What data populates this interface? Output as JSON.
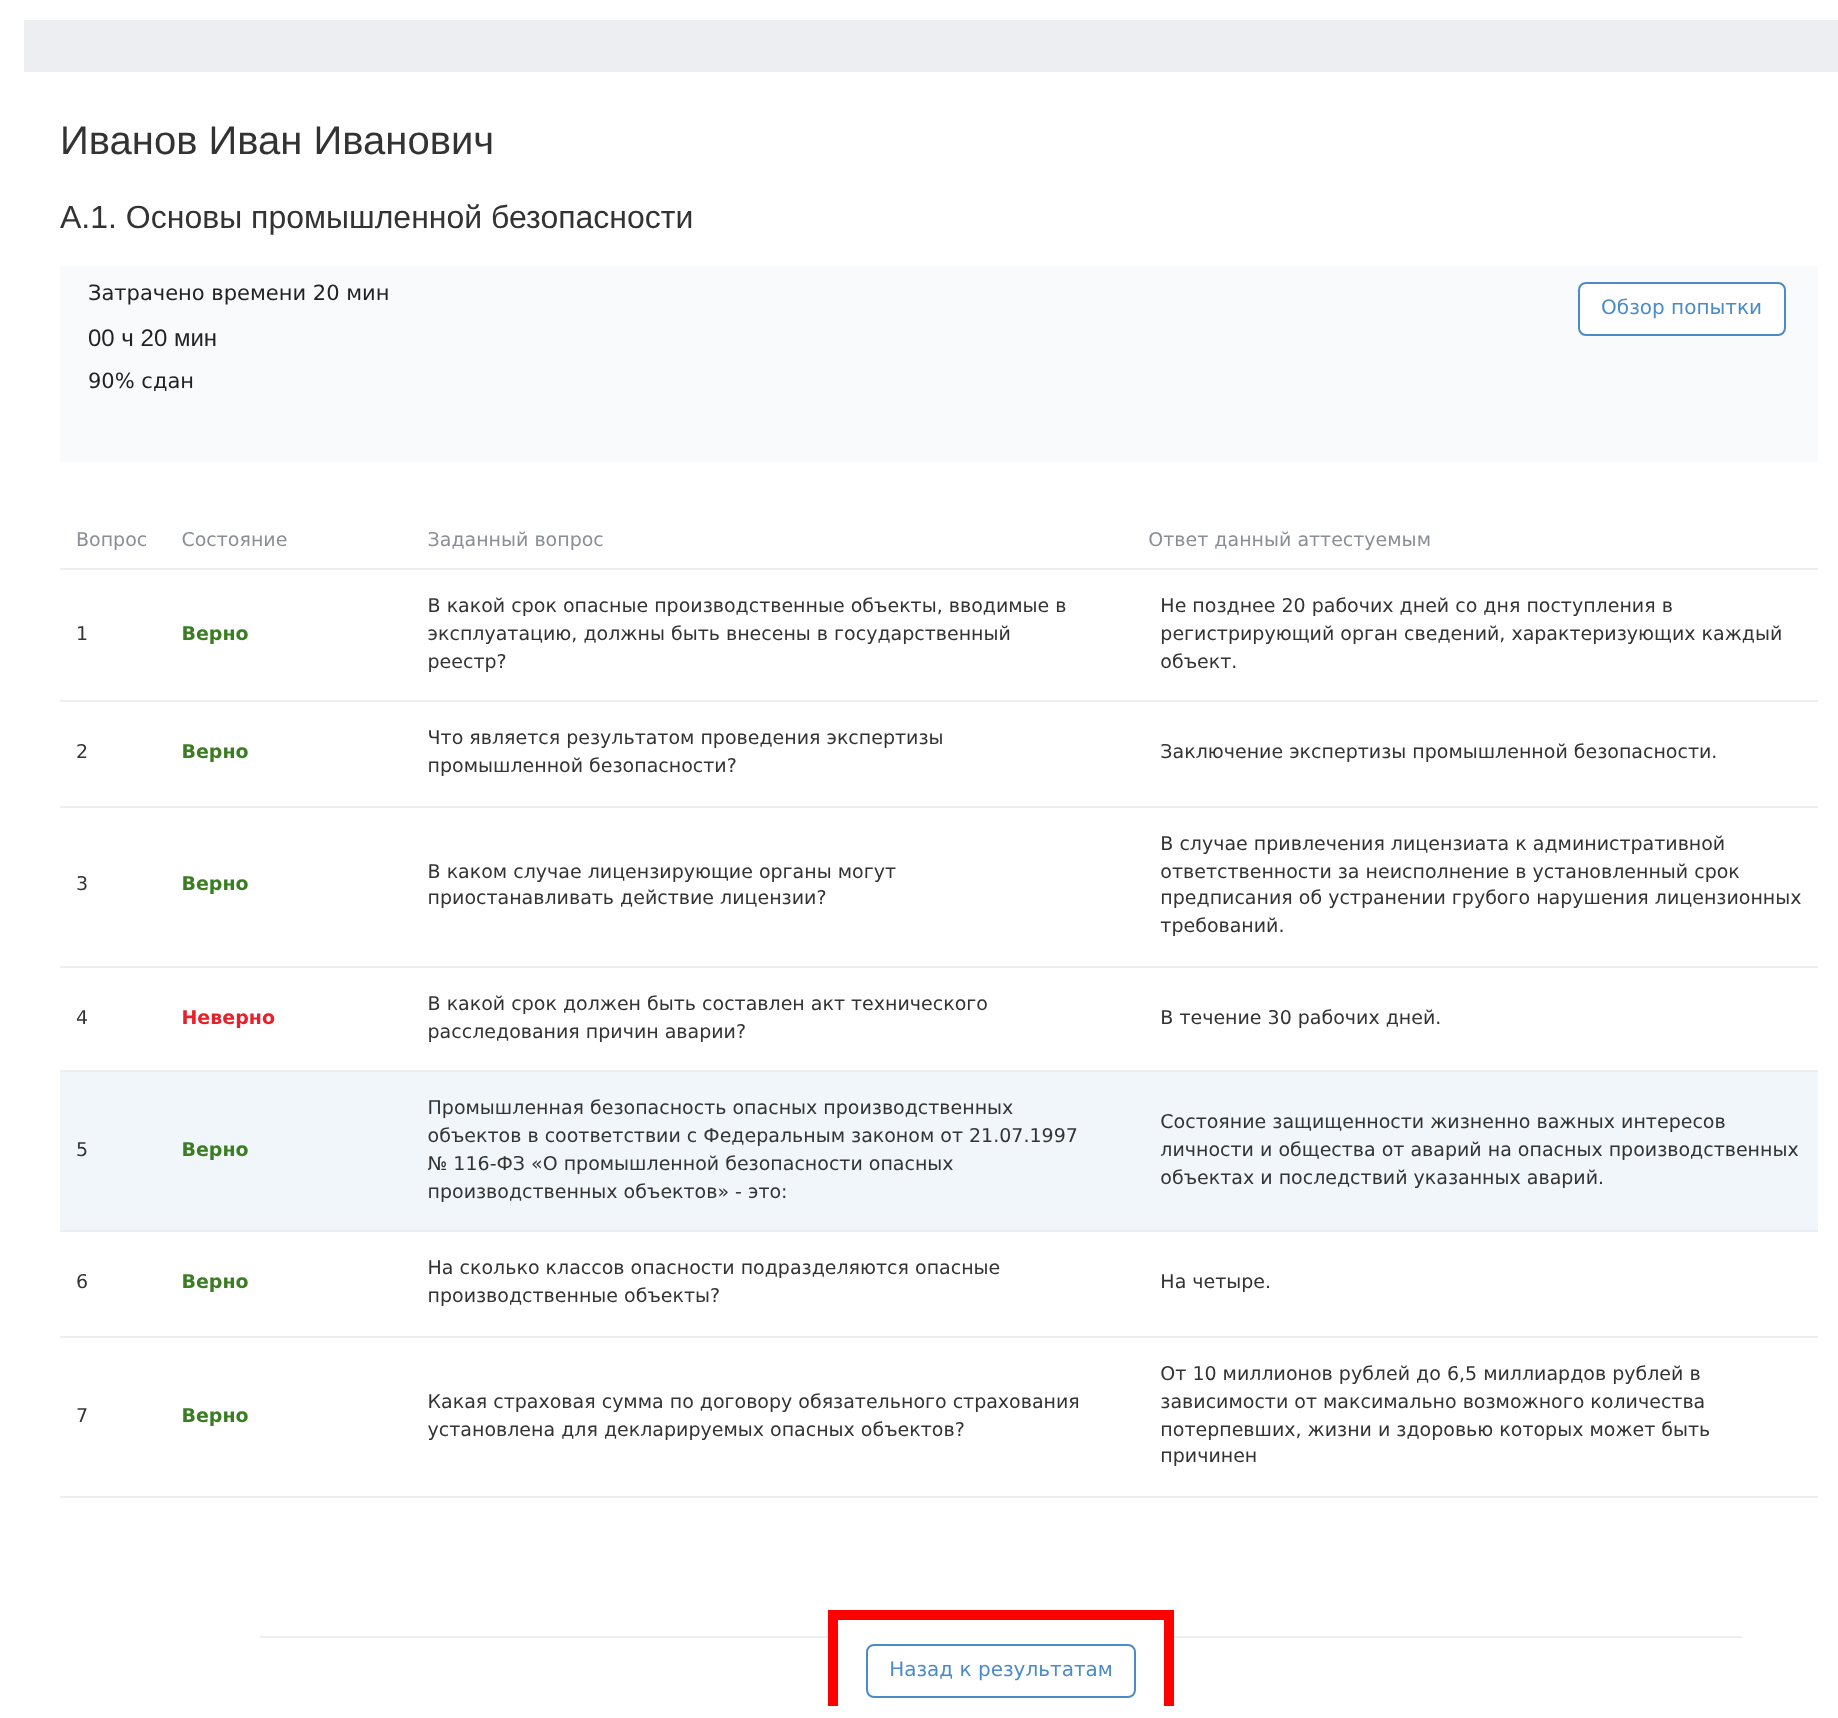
{
  "person": "Иванов Иван Иванович",
  "test_title": "А.1. Основы промышленной безопасности",
  "summary": {
    "time_spent": "Затрачено времени 20 мин",
    "duration": "00 ч 20 мин",
    "result": "90% сдан",
    "review_button": "Обзор попытки"
  },
  "table": {
    "columns": [
      "Вопрос",
      "Состояние",
      "Заданный вопрос",
      "Ответ данный аттестуемым"
    ],
    "rows": [
      {
        "number": "1",
        "status": "Верно",
        "correct": true,
        "selected": false,
        "question": "В какой срок опасные производственные объекты, вводимые в эксплуатацию, должны быть внесены в государственный реестр?",
        "answer": "Не позднее 20 рабочих дней со дня поступления в регистрирующий орган сведений, характеризующих каждый объект."
      },
      {
        "number": "2",
        "status": "Верно",
        "correct": true,
        "selected": false,
        "question": "Что является результатом проведения экспертизы промышленной безопасности?",
        "answer": "Заключение экспертизы промышленной безопасности."
      },
      {
        "number": "3",
        "status": "Верно",
        "correct": true,
        "selected": false,
        "question": "В каком случае лицензирующие органы могут приостанавливать действие лицензии?",
        "answer": "В случае привлечения лицензиата к административной ответственности за неисполнение в установленный срок предписания об устранении грубого нарушения лицензионных требований."
      },
      {
        "number": "4",
        "status": "Неверно",
        "correct": false,
        "selected": false,
        "question": "В какой срок должен быть составлен акт технического расследования причин аварии?",
        "answer": "В течение 30 рабочих дней."
      },
      {
        "number": "5",
        "status": "Верно",
        "correct": true,
        "selected": true,
        "question": "Промышленная безопасность опасных производственных объектов в соответствии с Федеральным законом от 21.07.1997 № 116-ФЗ «О промышленной безопасности опасных производственных объектов» - это:",
        "answer": "Состояние защищенности жизненно важных интересов личности и общества от аварий на опасных производственных объектах и последствий указанных аварий."
      },
      {
        "number": "6",
        "status": "Верно",
        "correct": true,
        "selected": false,
        "question": "На сколько классов опасности подразделяются опасные производственные объекты?",
        "answer": "На четыре."
      },
      {
        "number": "7",
        "status": "Верно",
        "correct": true,
        "selected": false,
        "question": "Какая страховая сумма по договору обязательного страхования установлена для декларируемых опасных объектов?",
        "answer": "От 10 миллионов рублей до 6,5 миллиардов рублей в зависимости от максимально возможного количества потерпевших, жизни и здоровью которых может быть причинен"
      }
    ]
  },
  "back_button": {
    "label": "Назад к результатам",
    "highlighted": true
  }
}
